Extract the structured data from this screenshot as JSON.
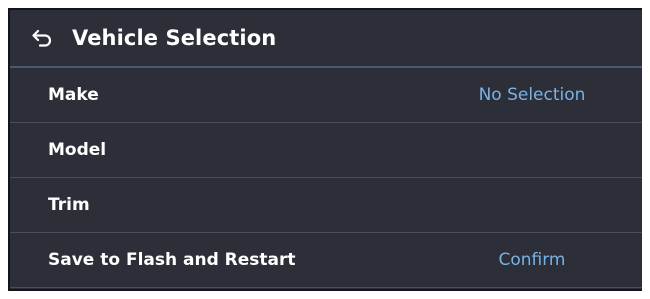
{
  "header": {
    "back_icon": "back-arrow-icon",
    "title": "Vehicle Selection"
  },
  "rows": [
    {
      "label": "Make",
      "value": "No Selection"
    },
    {
      "label": "Model",
      "value": ""
    },
    {
      "label": "Trim",
      "value": ""
    },
    {
      "label": "Save to Flash and Restart",
      "value": "Confirm"
    }
  ],
  "colors": {
    "background": "#2c2e38",
    "header_divider": "#465b72",
    "row_divider": "#4b4e58",
    "accent_value": "#7ab2e4",
    "text": "#ffffff"
  }
}
